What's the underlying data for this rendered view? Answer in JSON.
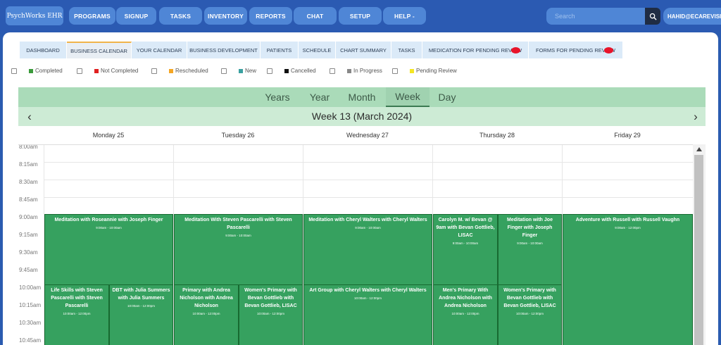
{
  "app": {
    "logo": "PsychWorks EHR"
  },
  "nav": [
    {
      "label": "PROGRAMS"
    },
    {
      "label": "SIGNUP"
    },
    {
      "label": "TASKS"
    },
    {
      "label": "INVENTORY"
    },
    {
      "label": "REPORTS"
    },
    {
      "label": "CHAT"
    },
    {
      "label": "SETUP"
    },
    {
      "label": "HELP -"
    }
  ],
  "search": {
    "placeholder": "Search",
    "icon": "search-icon"
  },
  "user": {
    "label": "HAHID@ECAREVISION"
  },
  "tabs": [
    {
      "label": "DASHBOARD"
    },
    {
      "label": "BUSINESS CALENDAR"
    },
    {
      "label": "YOUR CALENDAR"
    },
    {
      "label": "BUSINESS DEVELOPMENT"
    },
    {
      "label": "PATIENTS"
    },
    {
      "label": "SCHEDULE"
    },
    {
      "label": "CHART SUMMARY"
    },
    {
      "label": "TASKS"
    },
    {
      "label": "MEDICATION FOR PENDING REVIEW"
    },
    {
      "label": "FORMS FOR PENDING REVIEW"
    }
  ],
  "legend": [
    {
      "label": "Completed",
      "color": "#3a9a3a"
    },
    {
      "label": "Not Completed",
      "color": "#e02020"
    },
    {
      "label": "Rescheduled",
      "color": "#f5a623"
    },
    {
      "label": "New",
      "color": "#3aa0a0"
    },
    {
      "label": "Cancelled",
      "color": "#111111"
    },
    {
      "label": "In Progress",
      "color": "#888888"
    },
    {
      "label": "Pending Review",
      "color": "#f5e623"
    }
  ],
  "calendar": {
    "views": [
      "Years",
      "Year",
      "Month",
      "Week",
      "Day"
    ],
    "active_view": "Week",
    "title": "Week 13 (March 2024)",
    "prev": "‹",
    "next": "›",
    "days": [
      "Monday 25",
      "Tuesday 26",
      "Wednesday 27",
      "Thursday 28",
      "Friday 29"
    ],
    "times": [
      "8:00am",
      "8:15am",
      "8:30am",
      "8:45am",
      "9:00am",
      "9:15am",
      "9:30am",
      "9:45am",
      "10:00am",
      "10:15am",
      "10:30am",
      "10:45am"
    ],
    "event_color": "#36a15f",
    "events": [
      {
        "title": "Meditation with Roseannie with Joseph Finger",
        "time": "9:00am - 10:00am"
      },
      {
        "title": "Meditation With Steven Pascarelli with Steven Pascarelli",
        "time": "9:00am - 10:00am"
      },
      {
        "title": "Meditation with Cheryl Walters with Cheryl Walters",
        "time": "9:00am - 10:00am"
      },
      {
        "title": "Carolyn M. w/ Bevan @ 9am with Bevan Gottlieb, LISAC",
        "time": "9:00am - 10:00am"
      },
      {
        "title": "Meditation with Joe Finger with Joseph Finger",
        "time": "9:00am - 10:00am"
      },
      {
        "title": "Adventure with Russell with Russell Vaughn",
        "time": "9:00am - 12:00pm"
      },
      {
        "title": "Life Skills with Steven Pascarelli with Steven Pascarelli",
        "time": "10:00am - 12:00pm"
      },
      {
        "title": "DBT with Julia Summers with Julia Summers",
        "time": "10:00am - 12:00pm"
      },
      {
        "title": "Primary with Andrea Nicholson with Andrea Nicholson",
        "time": "10:00am - 12:00pm"
      },
      {
        "title": "Women's Primary with Bevan Gottlieb with Bevan Gottlieb, LISAC",
        "time": "10:00am - 12:00pm"
      },
      {
        "title": "Art Group with Cheryl Walters with Cheryl Walters",
        "time": "10:00am - 12:00pm"
      },
      {
        "title": "Men's Primary With Andrea Nicholson with Andrea Nicholson",
        "time": "10:00am - 12:00pm"
      },
      {
        "title": "Women's Primary with Bevan Gottlieb with Bevan Gottlieb, LISAC",
        "time": "10:00am - 12:00pm"
      }
    ]
  }
}
